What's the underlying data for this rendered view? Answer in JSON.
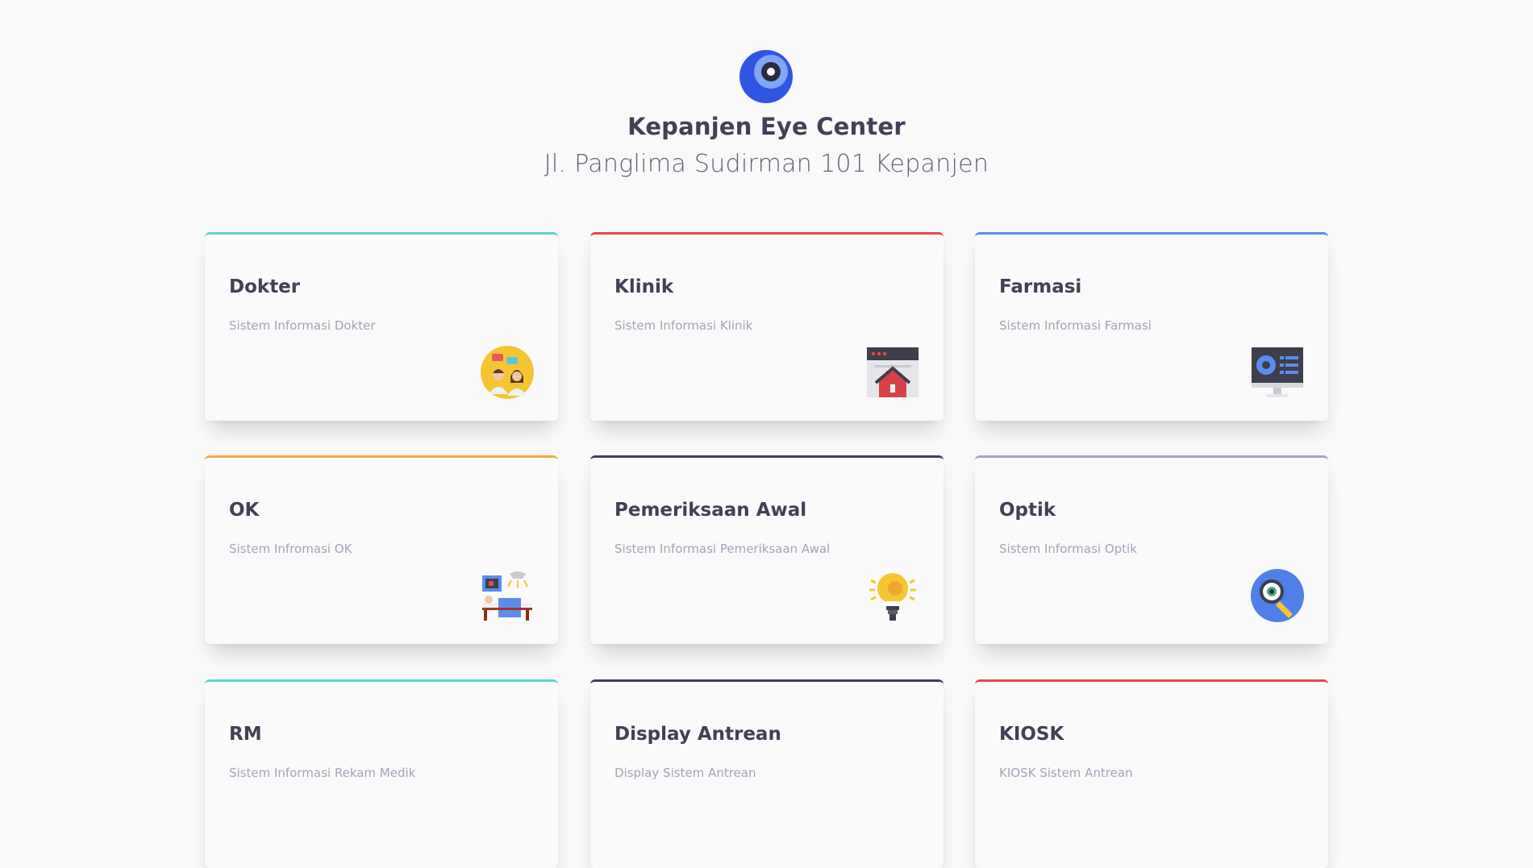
{
  "header": {
    "title": "Kepanjen Eye Center",
    "address": "Jl. Panglima Sudirman 101 Kepanjen",
    "logo_icon": "eye-logo-icon"
  },
  "colors": {
    "teal": "#5dd3d3",
    "red": "#e5484d",
    "blue": "#5b8def",
    "orange": "#f6a945",
    "dark": "#3f4254",
    "gray": "#a1a5b7"
  },
  "cards": [
    {
      "title": "Dokter",
      "subtitle": "Sistem Informasi Dokter",
      "accent": "#5dd3d3",
      "icon": "doctors-icon"
    },
    {
      "title": "Klinik",
      "subtitle": "Sistem Informasi Klinik",
      "accent": "#e5484d",
      "icon": "clinic-web-icon"
    },
    {
      "title": "Farmasi",
      "subtitle": "Sistem Informasi Farmasi",
      "accent": "#5b8def",
      "icon": "monitor-icon"
    },
    {
      "title": "OK",
      "subtitle": "Sistem Infromasi OK",
      "accent": "#f6a945",
      "icon": "operating-room-icon"
    },
    {
      "title": "Pemeriksaan Awal",
      "subtitle": "Sistem Informasi Pemeriksaan Awal",
      "accent": "#3f4254",
      "icon": "lightbulb-icon"
    },
    {
      "title": "Optik",
      "subtitle": "Sistem Informasi Optik",
      "accent": "#a1a5b7",
      "icon": "eye-magnifier-icon"
    },
    {
      "title": "RM",
      "subtitle": "Sistem Informasi Rekam Medik",
      "accent": "#5dd3d3",
      "icon": ""
    },
    {
      "title": "Display Antrean",
      "subtitle": "Display Sistem Antrean",
      "accent": "#3f4254",
      "icon": ""
    },
    {
      "title": "KIOSK",
      "subtitle": "KIOSK Sistem Antrean",
      "accent": "#e5484d",
      "icon": ""
    }
  ]
}
